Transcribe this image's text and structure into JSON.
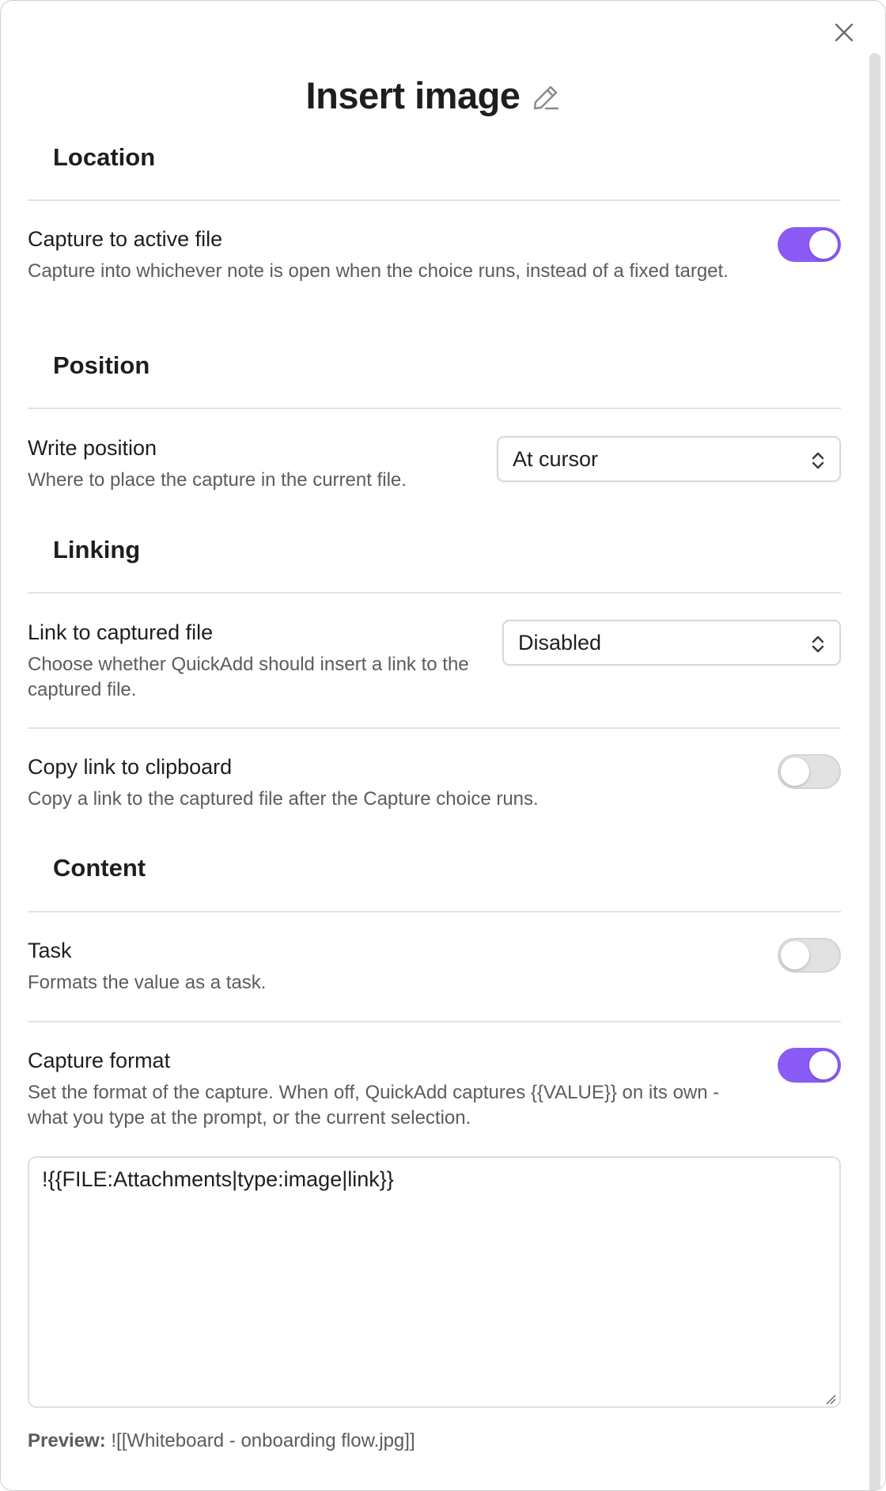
{
  "modal": {
    "title": "Insert image",
    "close_icon": "close-icon",
    "edit_icon": "pencil-icon"
  },
  "sections": {
    "location": "Location",
    "position": "Position",
    "linking": "Linking",
    "content": "Content"
  },
  "settings": {
    "capture_active": {
      "name": "Capture to active file",
      "desc": "Capture into whichever note is open when the choice runs, instead of a fixed target.",
      "enabled": true
    },
    "write_position": {
      "name": "Write position",
      "desc": "Where to place the capture in the current file.",
      "selected": "At cursor"
    },
    "link_captured": {
      "name": "Link to captured file",
      "desc": "Choose whether QuickAdd should insert a link to the captured file.",
      "selected": "Disabled"
    },
    "copy_link": {
      "name": "Copy link to clipboard",
      "desc": "Copy a link to the captured file after the Capture choice runs.",
      "enabled": false
    },
    "task": {
      "name": "Task",
      "desc": "Formats the value as a task.",
      "enabled": false
    },
    "capture_format": {
      "name": "Capture format",
      "desc": "Set the format of the capture. When off, QuickAdd captures {{VALUE}} on its own - what you type at the prompt, or the current selection.",
      "enabled": true,
      "value": "!{{FILE:Attachments|type:image|link}}"
    }
  },
  "preview": {
    "label": "Preview:",
    "value": "![[Whiteboard - onboarding flow.jpg]]"
  },
  "colors": {
    "accent": "#8a5cf5",
    "toggle_off": "#e2e2e2"
  }
}
